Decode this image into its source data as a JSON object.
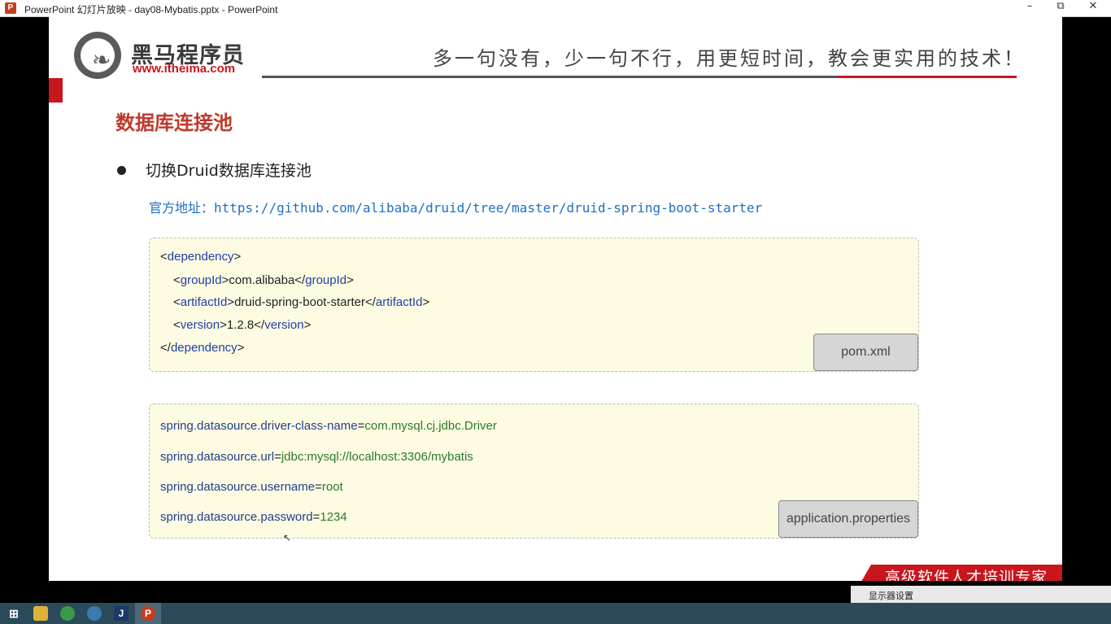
{
  "window": {
    "app_icon": "P",
    "title": "PowerPoint 幻灯片放映  -  day08-Mybatis.pptx - PowerPoint",
    "minimize_icon": "minimize-icon",
    "restore_icon": "restore-icon",
    "close_icon": "close-icon"
  },
  "slide": {
    "logo_cn": "黑马程序员",
    "logo_url": "www.itheima.com",
    "slogan": "多一句没有，少一句不行，用更短时间，教会更实用的技术！",
    "heading": "数据库连接池",
    "bullet": "切换Druid数据库连接池",
    "link_label": "官方地址：",
    "link_url": "https://github.com/alibaba/druid/tree/master/druid-spring-boot-starter",
    "pom": {
      "dep_open": "dependency",
      "group_tag": "groupId",
      "group_val": "com.alibaba",
      "artifact_tag": "artifactId",
      "artifact_val": "druid-spring-boot-starter",
      "version_tag": "version",
      "version_val": "1.2.8",
      "dep_close": "dependency",
      "file": "pom.xml"
    },
    "props": {
      "l1_key": "spring.datasource.driver-class-name",
      "l1_val": "com.mysql.cj.jdbc.Driver",
      "l2_key": "spring.datasource.url",
      "l2_val": "jdbc:mysql://localhost:3306/mybatis",
      "l3_key": "spring.datasource.username",
      "l3_val": "root",
      "l4_key": "spring.datasource.password",
      "l4_val": "1234",
      "file": "application.properties"
    },
    "footer": "高级软件人才培训专家"
  },
  "taskbar": {
    "status_text": "显示器设置"
  },
  "colors": {
    "brand_red": "#c8161e",
    "heading_red": "#c0392b",
    "link_blue": "#1f6fc5",
    "code_bg": "#fefbe3"
  }
}
